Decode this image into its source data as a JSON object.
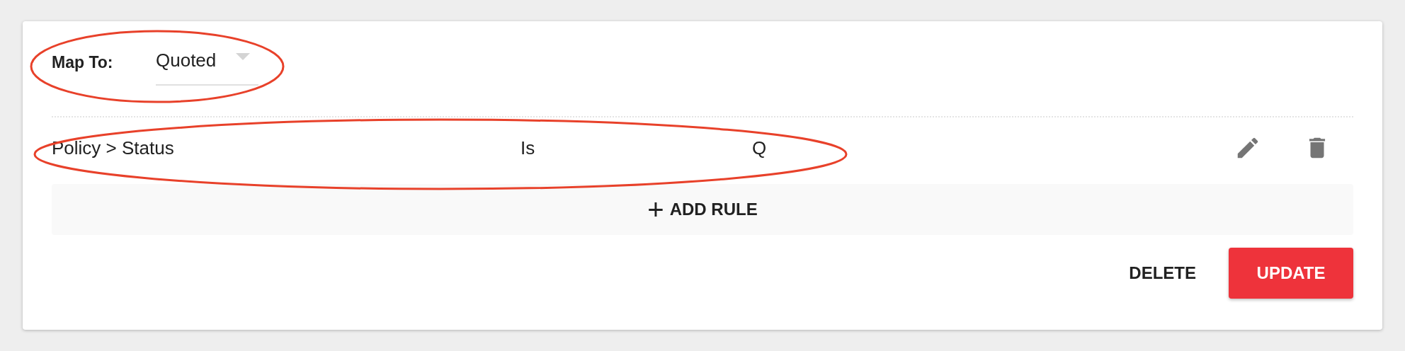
{
  "map_to": {
    "label": "Map To:",
    "value": "Quoted"
  },
  "rules": [
    {
      "field": "Policy > Status",
      "operator": "Is",
      "value": "Q"
    }
  ],
  "add_rule": {
    "icon": "+",
    "label": "ADD RULE"
  },
  "buttons": [
    {
      "kind": "text",
      "label": "DELETE"
    },
    {
      "kind": "primary",
      "label": "UPDATE"
    }
  ]
}
